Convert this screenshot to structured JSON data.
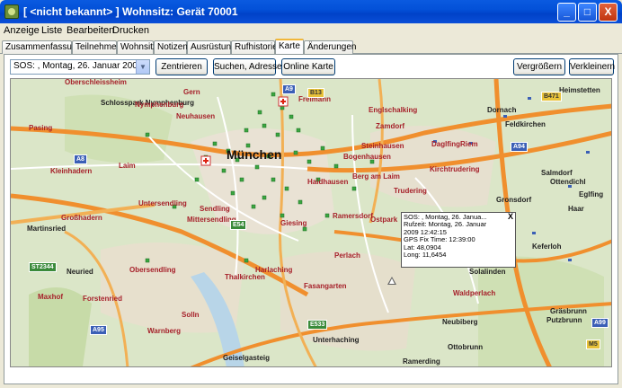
{
  "window": {
    "title": "[ <nicht bekannt> ] Wohnsitz: Gerät 70001",
    "minimize": "_",
    "maximize": "□",
    "close": "X"
  },
  "menu": {
    "items": [
      {
        "label": "Anzeige"
      },
      {
        "label": "Liste"
      },
      {
        "label": "Bearbeiten"
      },
      {
        "label": "Drucken"
      }
    ]
  },
  "tabs": [
    {
      "label": "Zusammenfassung"
    },
    {
      "label": "Teilnehmer"
    },
    {
      "label": "Wohnsitz"
    },
    {
      "label": "Notizen"
    },
    {
      "label": "Ausrüstung"
    },
    {
      "label": "Rufhistorie"
    },
    {
      "label": "Karte",
      "active": true
    },
    {
      "label": "Änderungen"
    }
  ],
  "toolbar": {
    "sos_select": "SOS: , Montag, 26. Januar 2009 12:42",
    "center": "Zentrieren",
    "search_address": "Suchen, Adresse",
    "online_map": "Online Karte",
    "zoom_in": "Vergrößern",
    "zoom_out": "Verkleinern"
  },
  "popup": {
    "title": "SOS: , Montag, 26. Janua...",
    "close": "X",
    "line1": "Rufzeit: Montag, 26. Januar",
    "line2": "2009 12:42:15",
    "line3": "GPS Fix Time: 12:39:00",
    "line4": "Lat: 48,0904",
    "line5": "Long: 11,6454"
  },
  "map": {
    "city": "München",
    "places": [
      {
        "name": "Oberschleissheim"
      },
      {
        "name": "Schlosspark Nymphenburg"
      },
      {
        "name": "Gern"
      },
      {
        "name": "Nymphenburg"
      },
      {
        "name": "Neuhausen"
      },
      {
        "name": "Freimann"
      },
      {
        "name": "Dornach"
      },
      {
        "name": "Heimstetten"
      },
      {
        "name": "Feldkirchen"
      },
      {
        "name": "Zamdorf"
      },
      {
        "name": "Englschalking"
      },
      {
        "name": "Pasing"
      },
      {
        "name": "Laim"
      },
      {
        "name": "Steinhausen"
      },
      {
        "name": "Daglfing"
      },
      {
        "name": "Riem"
      },
      {
        "name": "Bogenhausen"
      },
      {
        "name": "Haidhausen"
      },
      {
        "name": "Berg am Laim"
      },
      {
        "name": "Kirchtrudering"
      },
      {
        "name": "Trudering"
      },
      {
        "name": "Salmdorf"
      },
      {
        "name": "Ottendichl"
      },
      {
        "name": "Gronsdorf"
      },
      {
        "name": "Kleinhadern"
      },
      {
        "name": "Untersendling"
      },
      {
        "name": "Sendling"
      },
      {
        "name": "Mittersendling"
      },
      {
        "name": "Giesing"
      },
      {
        "name": "Ramersdorf"
      },
      {
        "name": "Ostpark"
      },
      {
        "name": "Perlach"
      },
      {
        "name": "Großhadern"
      },
      {
        "name": "Martinsried"
      },
      {
        "name": "Neuried"
      },
      {
        "name": "Obersendling"
      },
      {
        "name": "Thalkirchen"
      },
      {
        "name": "Harlaching"
      },
      {
        "name": "Fasangarten"
      },
      {
        "name": "Solalinden"
      },
      {
        "name": "Waldperlach"
      },
      {
        "name": "Forstenried"
      },
      {
        "name": "Solln"
      },
      {
        "name": "Warnberg"
      },
      {
        "name": "Neubiberg"
      },
      {
        "name": "Unterhaching"
      },
      {
        "name": "Ottobrunn"
      },
      {
        "name": "Geiselgasteig"
      },
      {
        "name": "Ramerding"
      },
      {
        "name": "Keferloh"
      },
      {
        "name": "Haar"
      },
      {
        "name": "Eglfing"
      },
      {
        "name": "Gräsbrunn"
      },
      {
        "name": "Putzbrunn"
      },
      {
        "name": "Maxhof"
      }
    ],
    "roads": [
      {
        "label": "A8"
      },
      {
        "label": "A9"
      },
      {
        "label": "A94"
      },
      {
        "label": "A95"
      },
      {
        "label": "A99"
      },
      {
        "label": "E54"
      },
      {
        "label": "E533"
      },
      {
        "label": "B13"
      },
      {
        "label": "M5"
      },
      {
        "label": "B471"
      },
      {
        "label": "ST2344"
      }
    ]
  }
}
